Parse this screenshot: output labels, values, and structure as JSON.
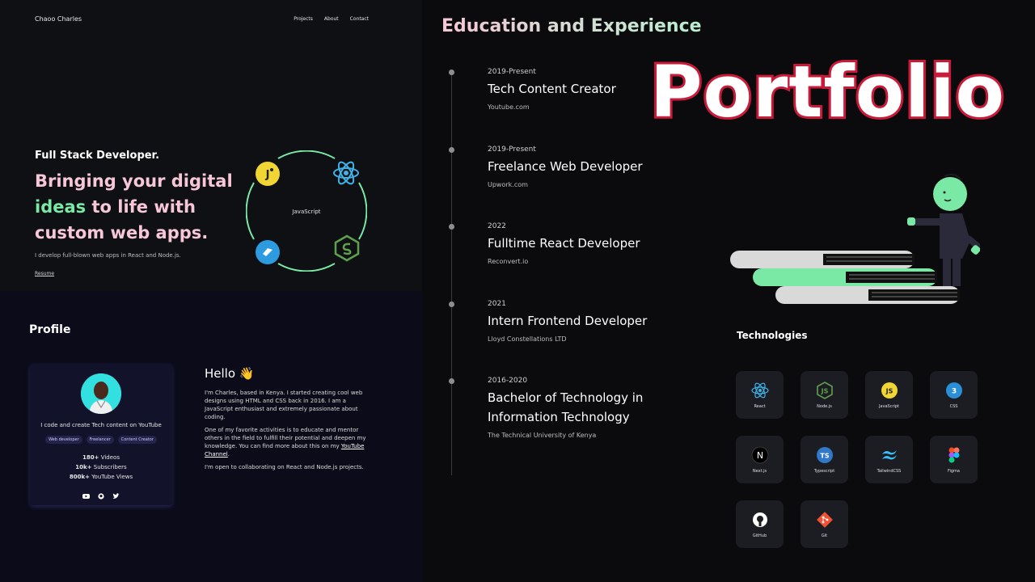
{
  "nav": {
    "brand": "Chaoo Charles",
    "links": [
      "Projects",
      "About",
      "Contact"
    ]
  },
  "hero": {
    "subtitle": "Full Stack Developer.",
    "title_part1": "Bringing your digital",
    "title_highlight": "ideas",
    "title_part2": " to life with custom web apps.",
    "description": "I develop full-blown web apps in React and Node.js.",
    "resume_link": "Resume",
    "orbit_label": "JavaScript"
  },
  "profile": {
    "heading": "Profile",
    "tagline": "I code and create Tech content on YouTube",
    "tags": [
      "Web developer",
      "Freelancer",
      "Content Creator"
    ],
    "stats": [
      {
        "value": "180+",
        "label": "Videos"
      },
      {
        "value": "10k+",
        "label": "Subscribers"
      },
      {
        "value": "800k+",
        "label": "YouTube Views"
      }
    ],
    "socials": [
      "youtube-icon",
      "github-icon",
      "twitter-icon"
    ]
  },
  "about": {
    "hello": "Hello 👋",
    "p1": "I'm Charles, based in Kenya. I started creating cool web designs using HTML and CSS back in 2016. I am a JavaScript enthusiast and extremely passionate about coding.",
    "p2_before": "One of my favorite activities is to educate and mentor others in the field to fulfill their potential and deepen my knowledge. You can find more about this on my ",
    "p2_link": "YouTube Channel",
    "p2_after": ".",
    "p3": "I'm open to collaborating on React and Node.js projects."
  },
  "education": {
    "title": "Education and Experience",
    "items": [
      {
        "date": "2019-Present",
        "role": "Tech Content Creator",
        "org": "Youtube.com"
      },
      {
        "date": "2019-Present",
        "role": "Freelance Web Developer",
        "org": "Upwork.com"
      },
      {
        "date": "2022",
        "role": "Fulltime React Developer",
        "org": "Reconvert.io"
      },
      {
        "date": "2021",
        "role": "Intern Frontend Developer",
        "org": "Lloyd Constellations LTD"
      },
      {
        "date": "2016-2020",
        "role": "Bachelor of Technology in Information Technology",
        "org": "The Technical University of Kenya"
      }
    ]
  },
  "overlay_title": "Portfolio",
  "technologies": {
    "title": "Technologies",
    "items": [
      {
        "label": "React",
        "icon": "react-icon"
      },
      {
        "label": "Node.js",
        "icon": "nodejs-icon"
      },
      {
        "label": "JavaScript",
        "icon": "javascript-icon"
      },
      {
        "label": "CSS",
        "icon": "css-icon"
      },
      {
        "label": "Next.js",
        "icon": "nextjs-icon"
      },
      {
        "label": "Typescript",
        "icon": "typescript-icon"
      },
      {
        "label": "TailwindCSS",
        "icon": "tailwind-icon"
      },
      {
        "label": "Figma",
        "icon": "figma-icon"
      },
      {
        "label": "GitHub",
        "icon": "github-icon"
      },
      {
        "label": "Git",
        "icon": "git-icon"
      }
    ]
  },
  "colors": {
    "accent_green": "#7be9a6",
    "accent_pink": "#f7c6d7",
    "portfolio_stroke": "#c91a3a"
  }
}
